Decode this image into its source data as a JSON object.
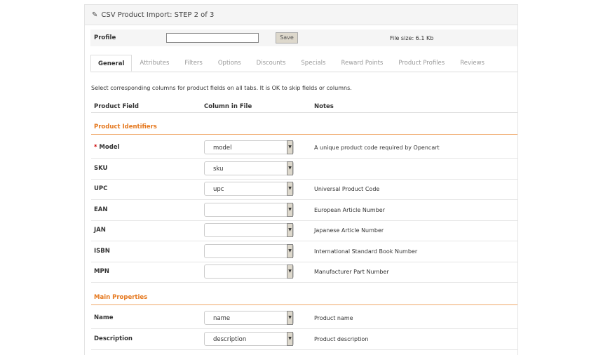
{
  "header": {
    "title": "CSV Product Import: STEP 2 of 3",
    "icon": "pencil-icon"
  },
  "profile": {
    "label": "Profile",
    "value": "",
    "save_label": "Save",
    "file_size": "File size: 6.1 Kb"
  },
  "tabs": [
    "General",
    "Attributes",
    "Filters",
    "Options",
    "Discounts",
    "Specials",
    "Reward Points",
    "Product Profiles",
    "Reviews"
  ],
  "active_tab": "General",
  "intro": "Select corresponding columns for product fields on all tabs. It is OK to skip fields or columns.",
  "columns": {
    "field": "Product Field",
    "column": "Column in File",
    "notes": "Notes"
  },
  "sections": [
    {
      "title": "Product Identifiers",
      "rows": [
        {
          "field": "Model",
          "required": "*",
          "value": "model",
          "note": "A unique product code required by Opencart"
        },
        {
          "field": "SKU",
          "value": "sku",
          "note": ""
        },
        {
          "field": "UPC",
          "value": "upc",
          "note": "Universal Product Code"
        },
        {
          "field": "EAN",
          "value": "",
          "note": "European Article Number"
        },
        {
          "field": "JAN",
          "value": "",
          "note": "Japanese Article Number"
        },
        {
          "field": "ISBN",
          "value": "",
          "note": "International Standard Book Number"
        },
        {
          "field": "MPN",
          "value": "",
          "note": "Manufacturer Part Number"
        }
      ]
    },
    {
      "title": "Main Properties",
      "rows": [
        {
          "field": "Name",
          "value": "name",
          "note": "Product name"
        },
        {
          "field": "Description",
          "value": "description",
          "note": "Product description"
        }
      ]
    }
  ]
}
